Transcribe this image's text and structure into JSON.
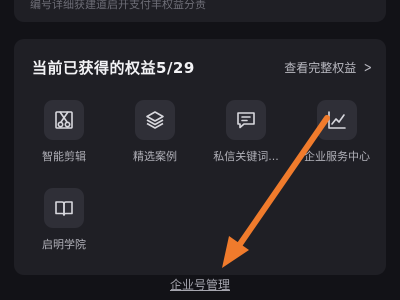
{
  "top_card": {
    "subtitle": "编号详细获建道启开支付丰权益分责"
  },
  "benefits": {
    "title": "当前已获得的权益5/29",
    "view_all_label": "查看完整权益",
    "items": [
      {
        "label": "智能剪辑",
        "icon": "scissors-icon"
      },
      {
        "label": "精选案例",
        "icon": "layers-icon"
      },
      {
        "label": "私信关键词...",
        "icon": "message-icon"
      },
      {
        "label": "企业服务中心",
        "icon": "line-chart-icon"
      },
      {
        "label": "启明学院",
        "icon": "book-icon"
      }
    ]
  },
  "footer": {
    "link_label": "企业号管理"
  },
  "annotation": {
    "arrow_color": "#f07b2c"
  }
}
